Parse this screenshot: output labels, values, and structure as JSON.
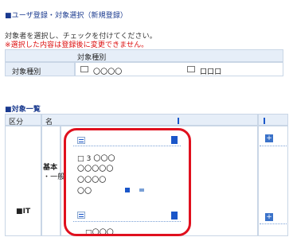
{
  "page": {
    "title": "■ユーザ登録・対象選択（新規登録）",
    "intro_line1": "対象者を選択し、チェックを付けてください。",
    "intro_line2": "※選択した内容は登録後に変更できません。"
  },
  "filter_box": {
    "header": "対象種別",
    "row_label": "対象種別",
    "option1": "〇〇〇〇",
    "option2": "口口口"
  },
  "section": {
    "title": "■対象一覧"
  },
  "table": {
    "headers": [
      "区分",
      "名",
      "",
      ""
    ],
    "row1": {
      "group_label": "基本",
      "subgroup": "・一般",
      "items": [
        "□ 3 〇〇〇",
        "〇〇〇〇〇",
        "〇〇〇〇",
        "〇〇"
      ],
      "right_btn": "+"
    },
    "row2": {
      "label": "■IT",
      "items": [
        "□〇〇〇"
      ],
      "right_btn": "+"
    }
  },
  "icons": {
    "blue": "#1a56c9",
    "accent_red": "#e0101e"
  }
}
